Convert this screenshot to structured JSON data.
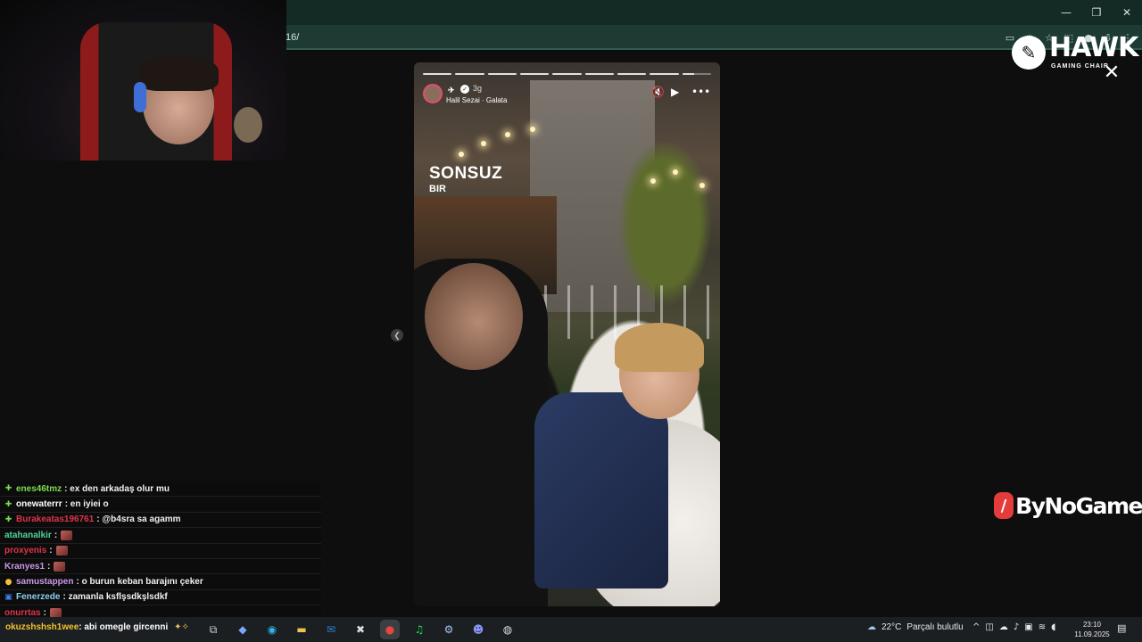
{
  "window": {
    "controls": [
      "—",
      "❐",
      "✕"
    ]
  },
  "address_bar": {
    "url_fragment": "16/"
  },
  "story": {
    "progress_segments": 9,
    "current_segment": 9,
    "time_ago": "3g",
    "music": "Halil Sezai · Galata",
    "sticker_title": "SONSUZ",
    "sticker_subtitle": "BIR"
  },
  "overlays": {
    "hawk_name": "HAWK",
    "hawk_sub": "GAMING CHAIR",
    "bynogame": "ByNoGame"
  },
  "chat": {
    "messages": [
      {
        "badge": "plus-icon",
        "badge_color": "#7ddb4f",
        "user": "enes46tmz",
        "user_color": "#7ddb4f",
        "text": ": ex den arkadaş olur mu",
        "emote": false
      },
      {
        "badge": "plus-icon",
        "badge_color": "#7ddb4f",
        "user": "onewaterrr",
        "user_color": "#ffffff",
        "text": ": en iyiei o",
        "emote": false
      },
      {
        "badge": "plus-icon",
        "badge_color": "#7ddb4f",
        "user": "Burakeatas196761",
        "user_color": "#e0344a",
        "text": ": @b4sra sa agamm",
        "emote": false
      },
      {
        "badge": "",
        "badge_color": "",
        "user": "atahanalkir",
        "user_color": "#4fd39a",
        "text": ":",
        "emote": true
      },
      {
        "badge": "",
        "badge_color": "",
        "user": "proxyenis",
        "user_color": "#e0344a",
        "text": ":",
        "emote": true
      },
      {
        "badge": "",
        "badge_color": "",
        "user": "Kranyes1",
        "user_color": "#c99ae8",
        "text": ":",
        "emote": true
      },
      {
        "badge": "coin-icon",
        "badge_color": "#f2c230",
        "user": "samustappen",
        "user_color": "#c99ae8",
        "text": ": o burun keban barajını çeker",
        "emote": false
      },
      {
        "badge": "sub-badge-icon",
        "badge_color": "#3b82f6",
        "user": "Fenerzede",
        "user_color": "#8ad0f0",
        "text": ": zamanla ksflşsdkşlsdkf",
        "emote": false
      },
      {
        "badge": "",
        "badge_color": "",
        "user": "onurrtas",
        "user_color": "#e0344a",
        "text": ":",
        "emote": true
      }
    ],
    "input_user": "okuzshshsh1wee",
    "input_text": ": abi omegle gircenni"
  },
  "taskbar": {
    "apps": [
      {
        "icon": "task-view-icon",
        "glyph": "⧉",
        "color": "#cfd3d6"
      },
      {
        "icon": "copilot-icon",
        "glyph": "◆",
        "color": "#7aa7ff"
      },
      {
        "icon": "edge-icon",
        "glyph": "◉",
        "color": "#2fb5e8"
      },
      {
        "icon": "file-explorer-icon",
        "glyph": "▬",
        "color": "#f2c14e"
      },
      {
        "icon": "outlook-icon",
        "glyph": "✉",
        "color": "#2a7fd4"
      },
      {
        "icon": "xbox-icon",
        "glyph": "✖",
        "color": "#dcdcdc"
      },
      {
        "icon": "chrome-icon",
        "glyph": "●",
        "color": "#e8453c"
      },
      {
        "icon": "spotify-icon",
        "glyph": "♫",
        "color": "#1ed760"
      },
      {
        "icon": "steam-icon",
        "glyph": "⚙",
        "color": "#9ec6f0"
      },
      {
        "icon": "discord-icon",
        "glyph": "☻",
        "color": "#8a96f7"
      },
      {
        "icon": "obs-icon",
        "glyph": "◍",
        "color": "#dddddd"
      }
    ],
    "weather_temp": "22°C",
    "weather_text": "Parçalı bulutlu",
    "time": "23:10",
    "date": "11.09.2025"
  }
}
